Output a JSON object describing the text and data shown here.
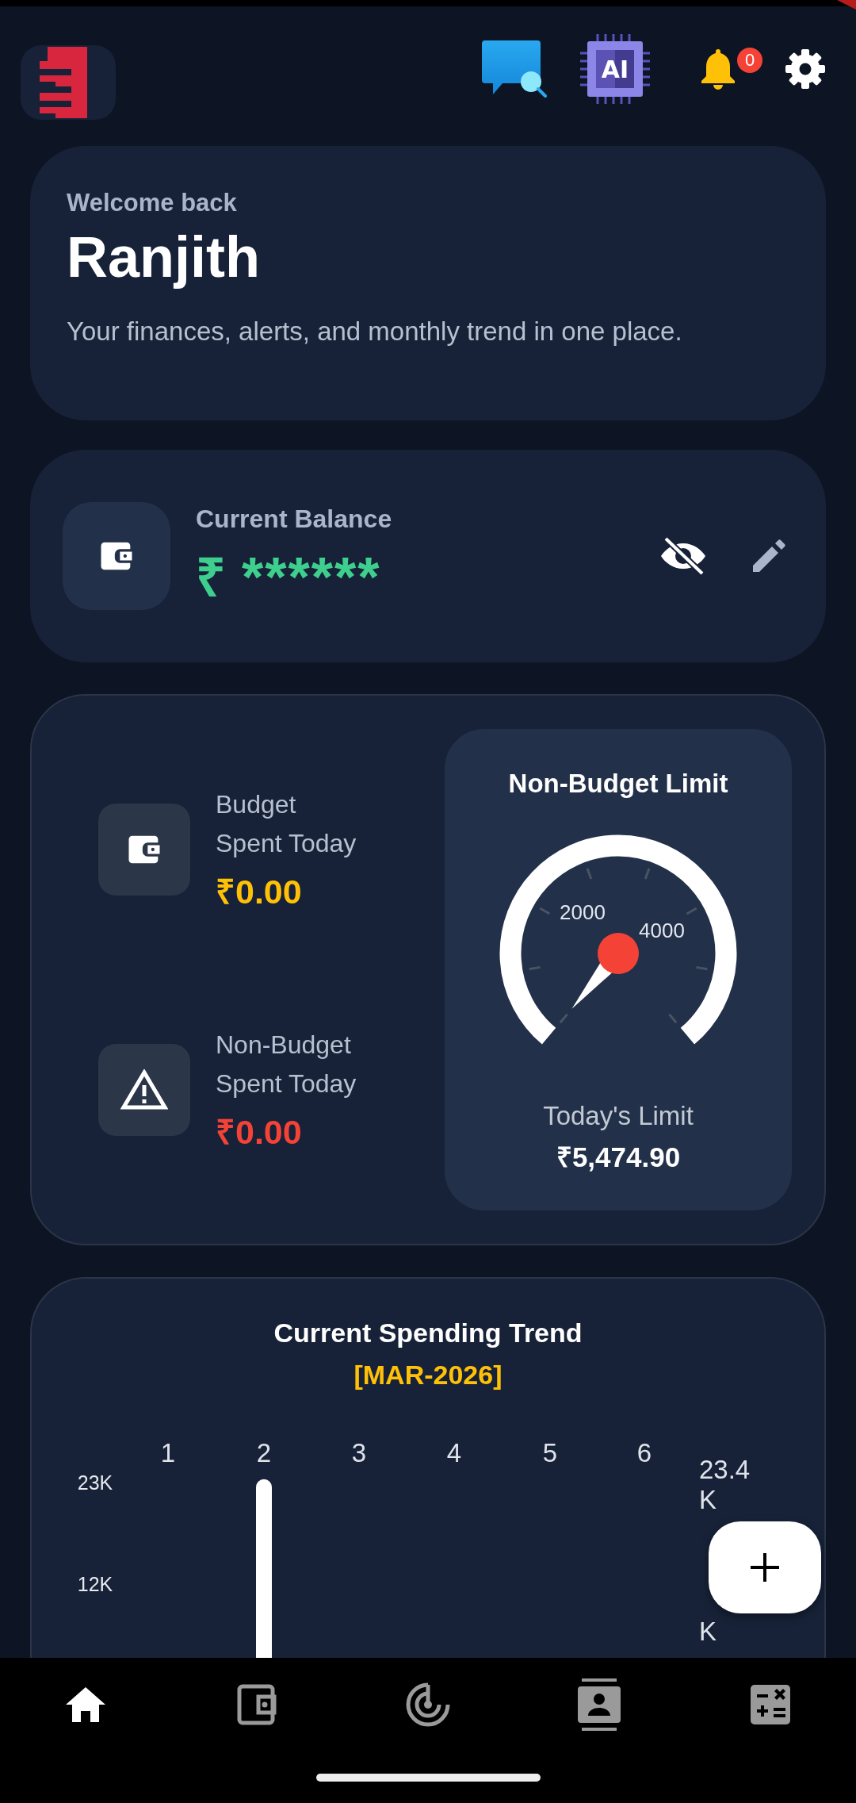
{
  "header": {
    "ai_label": "AI",
    "notification_count": "0"
  },
  "welcome": {
    "greeting": "Welcome back",
    "name": "Ranjith",
    "subtitle": "Your finances, alerts, and monthly trend in one place."
  },
  "balance": {
    "label": "Current Balance",
    "currency": "₹",
    "amount": "******",
    "hidden": true
  },
  "today": {
    "items": [
      {
        "kind": "budget",
        "label": "Budget Spent Today",
        "amount": "₹0.00",
        "color": "#ffc107"
      },
      {
        "kind": "non_budget",
        "label": "Non-Budget Spent Today",
        "amount": "₹0.00",
        "color": "#f44336"
      }
    ],
    "gauge": {
      "title": "Non-Budget Limit",
      "tick_labels": [
        "2000",
        "4000"
      ],
      "caption": "Today's Limit",
      "value": "₹5,474.90"
    }
  },
  "trend": {
    "title": "Current Spending Trend",
    "period": "[MAR-2026]",
    "chart_data": {
      "type": "bar",
      "categories": [
        "1",
        "2",
        "3",
        "4",
        "5",
        "6"
      ],
      "values": [
        0,
        23400,
        0,
        0,
        0,
        0
      ],
      "ylim": [
        0,
        23400
      ],
      "yticks": [
        {
          "value": 12000,
          "label": "12K"
        },
        {
          "value": 23000,
          "label": "23K"
        }
      ]
    },
    "side_labels": [
      "23.4 K",
      "K"
    ]
  },
  "nav": [
    {
      "kind": "home",
      "selected": true
    },
    {
      "kind": "wallet",
      "selected": false
    },
    {
      "kind": "radar",
      "selected": false
    },
    {
      "kind": "contacts",
      "selected": false
    },
    {
      "kind": "calculator",
      "selected": false
    }
  ]
}
